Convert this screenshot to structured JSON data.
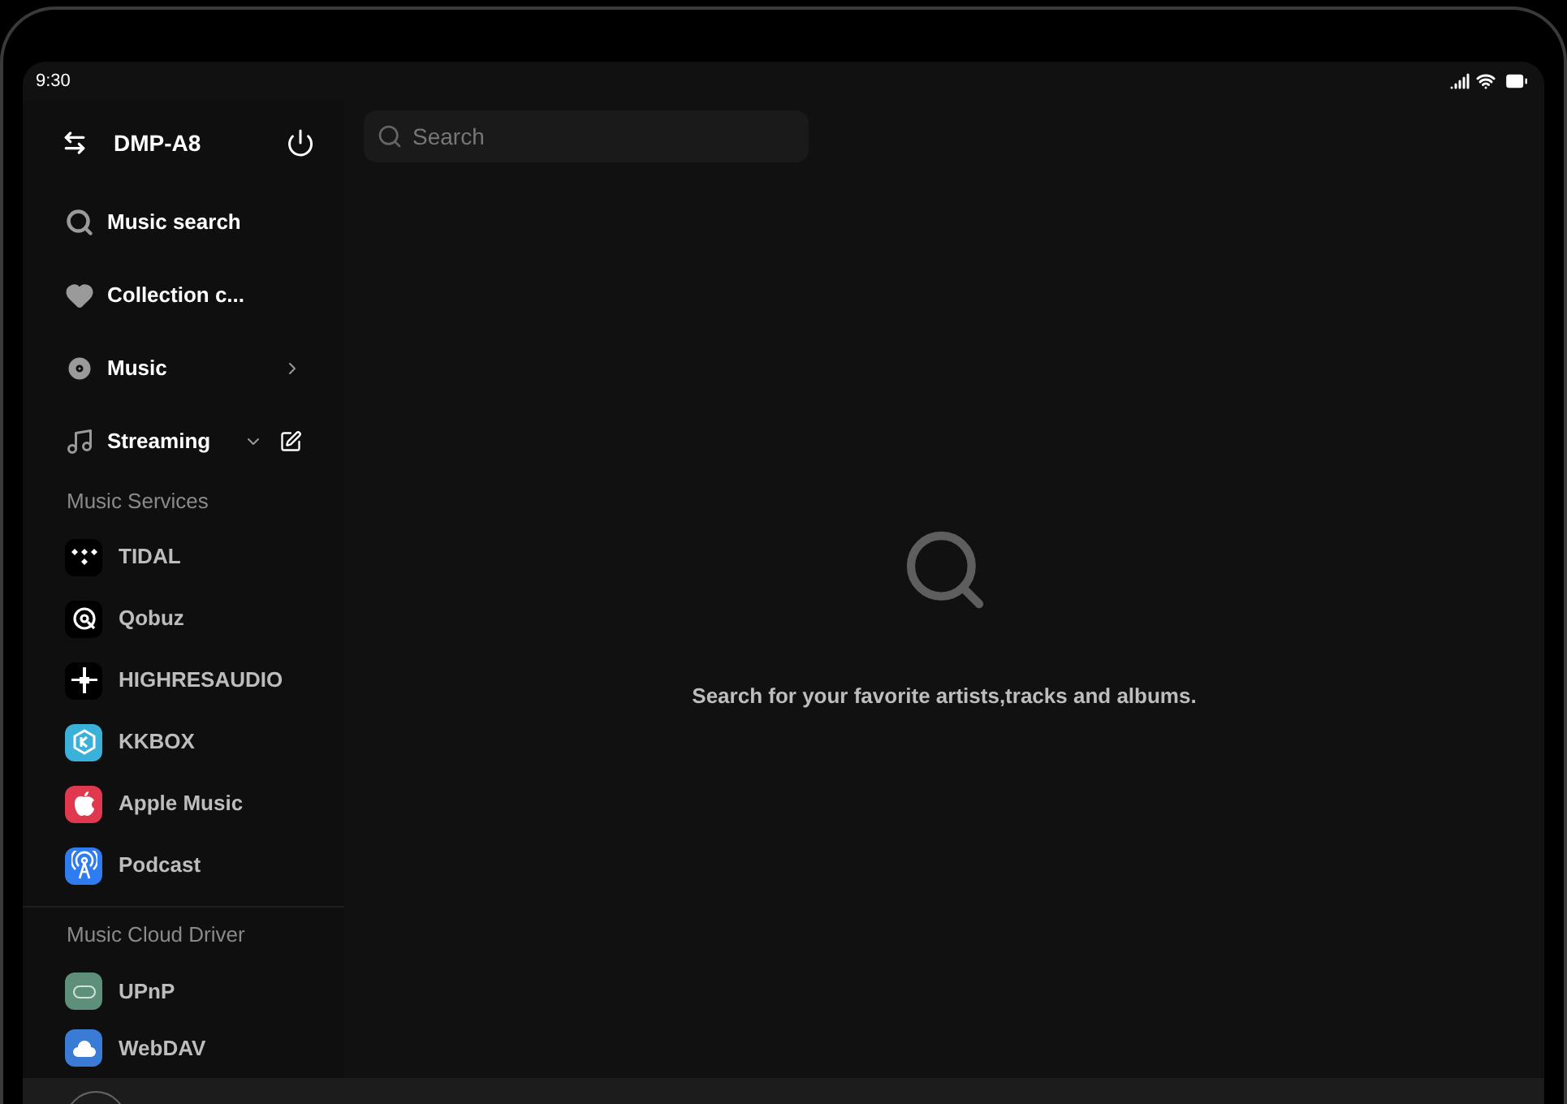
{
  "status_bar": {
    "time": "9:30"
  },
  "sidebar": {
    "device": "DMP-A8",
    "nav_items": [
      {
        "label": "Music search",
        "kind": "search"
      },
      {
        "label": "Collection c...",
        "kind": "favorites"
      },
      {
        "label": "Music",
        "kind": "library",
        "expanded": false
      },
      {
        "label": "Streaming",
        "kind": "streaming",
        "expanded": true
      }
    ],
    "sections": [
      {
        "title": "Music Services",
        "items": [
          {
            "label": "TIDAL",
            "kind": "tidal",
            "color": "#000000"
          },
          {
            "label": "Qobuz",
            "kind": "qobuz",
            "color": "#000000"
          },
          {
            "label": "HIGHRESAUDIO",
            "kind": "highresaudio",
            "color": "#000000"
          },
          {
            "label": "KKBOX",
            "kind": "kkbox",
            "color": "#3bb0d8"
          },
          {
            "label": "Apple Music",
            "kind": "apple",
            "color": "#e0394f"
          },
          {
            "label": "Podcast",
            "kind": "podcast",
            "color": "#2f7cf0"
          }
        ]
      },
      {
        "title": "Music Cloud Driver",
        "items": [
          {
            "label": "UPnP",
            "kind": "upnp",
            "color": "#5e8f7a"
          },
          {
            "label": "WebDAV",
            "kind": "webdav",
            "color": "#3a7bd5"
          }
        ]
      }
    ]
  },
  "main": {
    "search": {
      "placeholder": "Search"
    },
    "empty_message": "Search for your favorite artists,tracks and albums."
  }
}
